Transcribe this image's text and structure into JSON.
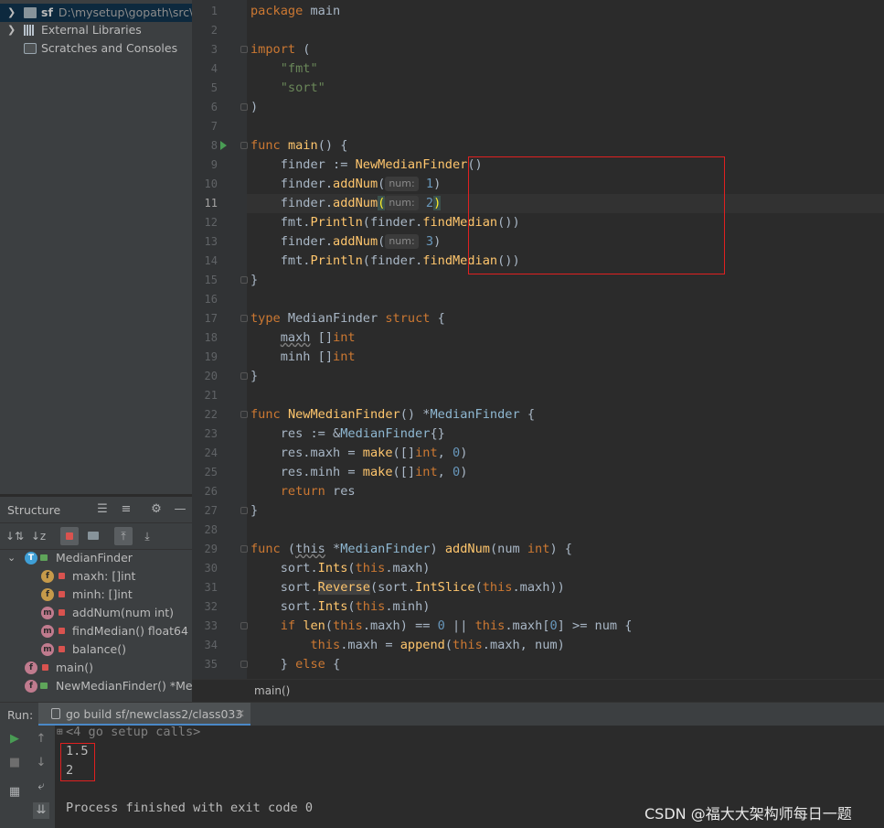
{
  "project": {
    "items": [
      {
        "name": "sf",
        "path": "D:\\mysetup\\gopath\\src\\sf"
      },
      {
        "name": "External Libraries"
      },
      {
        "name": "Scratches and Consoles"
      }
    ]
  },
  "structure": {
    "title": "Structure",
    "items": [
      {
        "label": "MedianFinder",
        "badge": "T"
      },
      {
        "label": "maxh: []int",
        "badge": "f"
      },
      {
        "label": "minh: []int",
        "badge": "f"
      },
      {
        "label": "addNum(num int)",
        "badge": "m"
      },
      {
        "label": "findMedian() float64",
        "badge": "m"
      },
      {
        "label": "balance()",
        "badge": "m"
      },
      {
        "label": "main()",
        "badge": "f"
      },
      {
        "label": "NewMedianFinder() *Med",
        "badge": "f"
      }
    ]
  },
  "editor": {
    "line_numbers": [
      "1",
      "2",
      "3",
      "4",
      "5",
      "6",
      "7",
      "8",
      "9",
      "10",
      "11",
      "12",
      "13",
      "14",
      "15",
      "16",
      "17",
      "18",
      "19",
      "20",
      "21",
      "22",
      "23",
      "24",
      "25",
      "26",
      "27",
      "28",
      "29",
      "30",
      "31",
      "32",
      "33",
      "34",
      "35"
    ],
    "current_line": "11",
    "breadcrumb": "main()",
    "hint_label": "num:"
  },
  "run": {
    "label": "Run:",
    "tab_title": "go build sf/newclass2/class033",
    "collapsed": "<4 go setup calls>",
    "output": [
      "1.5",
      "2"
    ],
    "exit": "Process finished with exit code 0"
  },
  "watermark": "CSDN @福大大架构师每日一题",
  "colors": {
    "keyword": "#cc7832",
    "string": "#6a8759",
    "function": "#ffc66d",
    "number": "#6897bb",
    "highlight_box": "#e02020"
  }
}
